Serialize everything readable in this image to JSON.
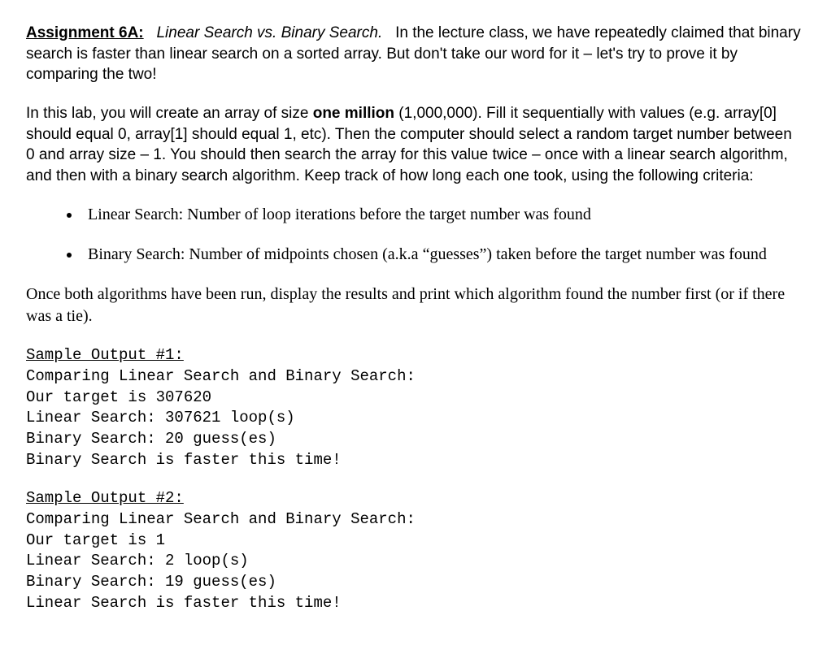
{
  "heading": {
    "label": "Assignment 6A:",
    "subtitle": "Linear Search vs. Binary Search."
  },
  "intro": "In the lecture class, we have repeatedly claimed that binary search is faster than linear search on a sorted array. But don't take our word for it – let's try to prove it by comparing the two!",
  "para2_a": "In this lab, you will create an array of size ",
  "para2_bold": "one million",
  "para2_b": " (1,000,000). Fill it sequentially with values (e.g. array[0] should equal 0, array[1] should equal 1, etc). Then the computer should select a random target number between 0 and array size – 1. You should then search the array for this value twice – once with a linear search algorithm, and then with a binary search algorithm. Keep track of how long each one took, using the following criteria:",
  "bullets": [
    "Linear Search: Number of loop iterations before the target number was found",
    "Binary Search: Number of midpoints chosen (a.k.a “guesses”) taken before the target number was found"
  ],
  "para3": "Once both algorithms have been run, display the results and print which algorithm found the number first (or if there was a tie).",
  "sample1": {
    "heading": "Sample Output #1:",
    "body": "Comparing Linear Search and Binary Search:\nOur target is 307620\nLinear Search: 307621 loop(s)\nBinary Search: 20 guess(es)\nBinary Search is faster this time!"
  },
  "sample2": {
    "heading": "Sample Output #2:",
    "body": "Comparing Linear Search and Binary Search:\nOur target is 1\nLinear Search: 2 loop(s)\nBinary Search: 19 guess(es)\nLinear Search is faster this time!"
  }
}
